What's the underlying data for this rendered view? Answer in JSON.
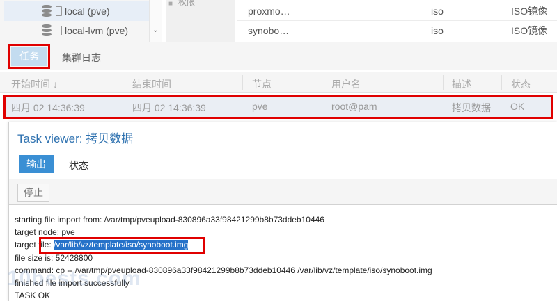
{
  "storage_tree": {
    "items": [
      {
        "label": "local (pve)",
        "icon": "database-icon"
      },
      {
        "label": "local-lvm (pve)",
        "icon": "database-icon"
      }
    ]
  },
  "side_panel": {
    "label": "权限"
  },
  "iso_list": {
    "rows": [
      {
        "name": "proxmo…",
        "format": "iso",
        "type": "ISO镜像"
      },
      {
        "name": "synobo…",
        "format": "iso",
        "type": "ISO镜像"
      }
    ]
  },
  "bottom_tabs": {
    "task": "任务",
    "cluster_log": "集群日志"
  },
  "tasks_table": {
    "columns": [
      "开始时间 ↓",
      "结束时间",
      "节点",
      "用户名",
      "描述",
      "状态"
    ],
    "rows": [
      {
        "start": "四月 02 14:36:39",
        "end": "四月 02 14:36:39",
        "node": "pve",
        "user": "root@pam",
        "desc": "拷贝数据",
        "status": "OK"
      }
    ]
  },
  "task_viewer": {
    "title": "Task viewer: 拷贝数据",
    "tab_output": "输出",
    "tab_status": "状态",
    "stop_button": "停止",
    "log": {
      "line1": "starting file import from: /var/tmp/pveupload-830896a33f98421299b8b73ddeb10446",
      "line2": "target node: pve",
      "line3_prefix": "target file: ",
      "line3_path": "/var/lib/vz/template/iso/synoboot.img",
      "line4": "file size is: 52428800",
      "line5": "command: cp -- /var/tmp/pveupload-830896a33f98421299b8b73ddeb10446 /var/lib/vz/template/iso/synoboot.img",
      "line6": "finished file import successfully",
      "line7": "TASK OK"
    }
  },
  "watermark": "10bests.com",
  "colors": {
    "accent": "#3a8fd4",
    "highlight_box": "#e00000",
    "selection": "#2672c9"
  }
}
